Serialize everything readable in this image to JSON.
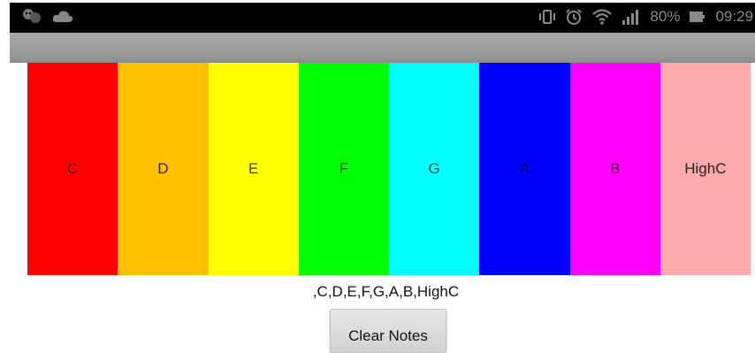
{
  "status_bar": {
    "icons_left": [
      "chat-bubbles-icon",
      "cloud-icon"
    ],
    "icons_right": [
      "vibrate-icon",
      "alarm-icon",
      "wifi-icon",
      "signal-icon",
      "battery-icon"
    ],
    "battery_percent": "80%",
    "time": "09:29"
  },
  "keys": [
    {
      "label": "C",
      "color": "#ff0000",
      "text_color": "#3a0000"
    },
    {
      "label": "D",
      "color": "#ffc000",
      "text_color": "#3a2a00"
    },
    {
      "label": "E",
      "color": "#ffff00",
      "text_color": "#3a3a00"
    },
    {
      "label": "F",
      "color": "#00ff00",
      "text_color": "#005500"
    },
    {
      "label": "G",
      "color": "#00ffff",
      "text_color": "#004444"
    },
    {
      "label": "A",
      "color": "#0000ff",
      "text_color": "#000055"
    },
    {
      "label": "B",
      "color": "#ff00ff",
      "text_color": "#550055"
    },
    {
      "label": "HighC",
      "color": "#ffaaaa",
      "text_color": "#222222"
    }
  ],
  "notes_played": ",C,D,E,F,G,A,B,HighC",
  "clear_button_label": "Clear Notes"
}
